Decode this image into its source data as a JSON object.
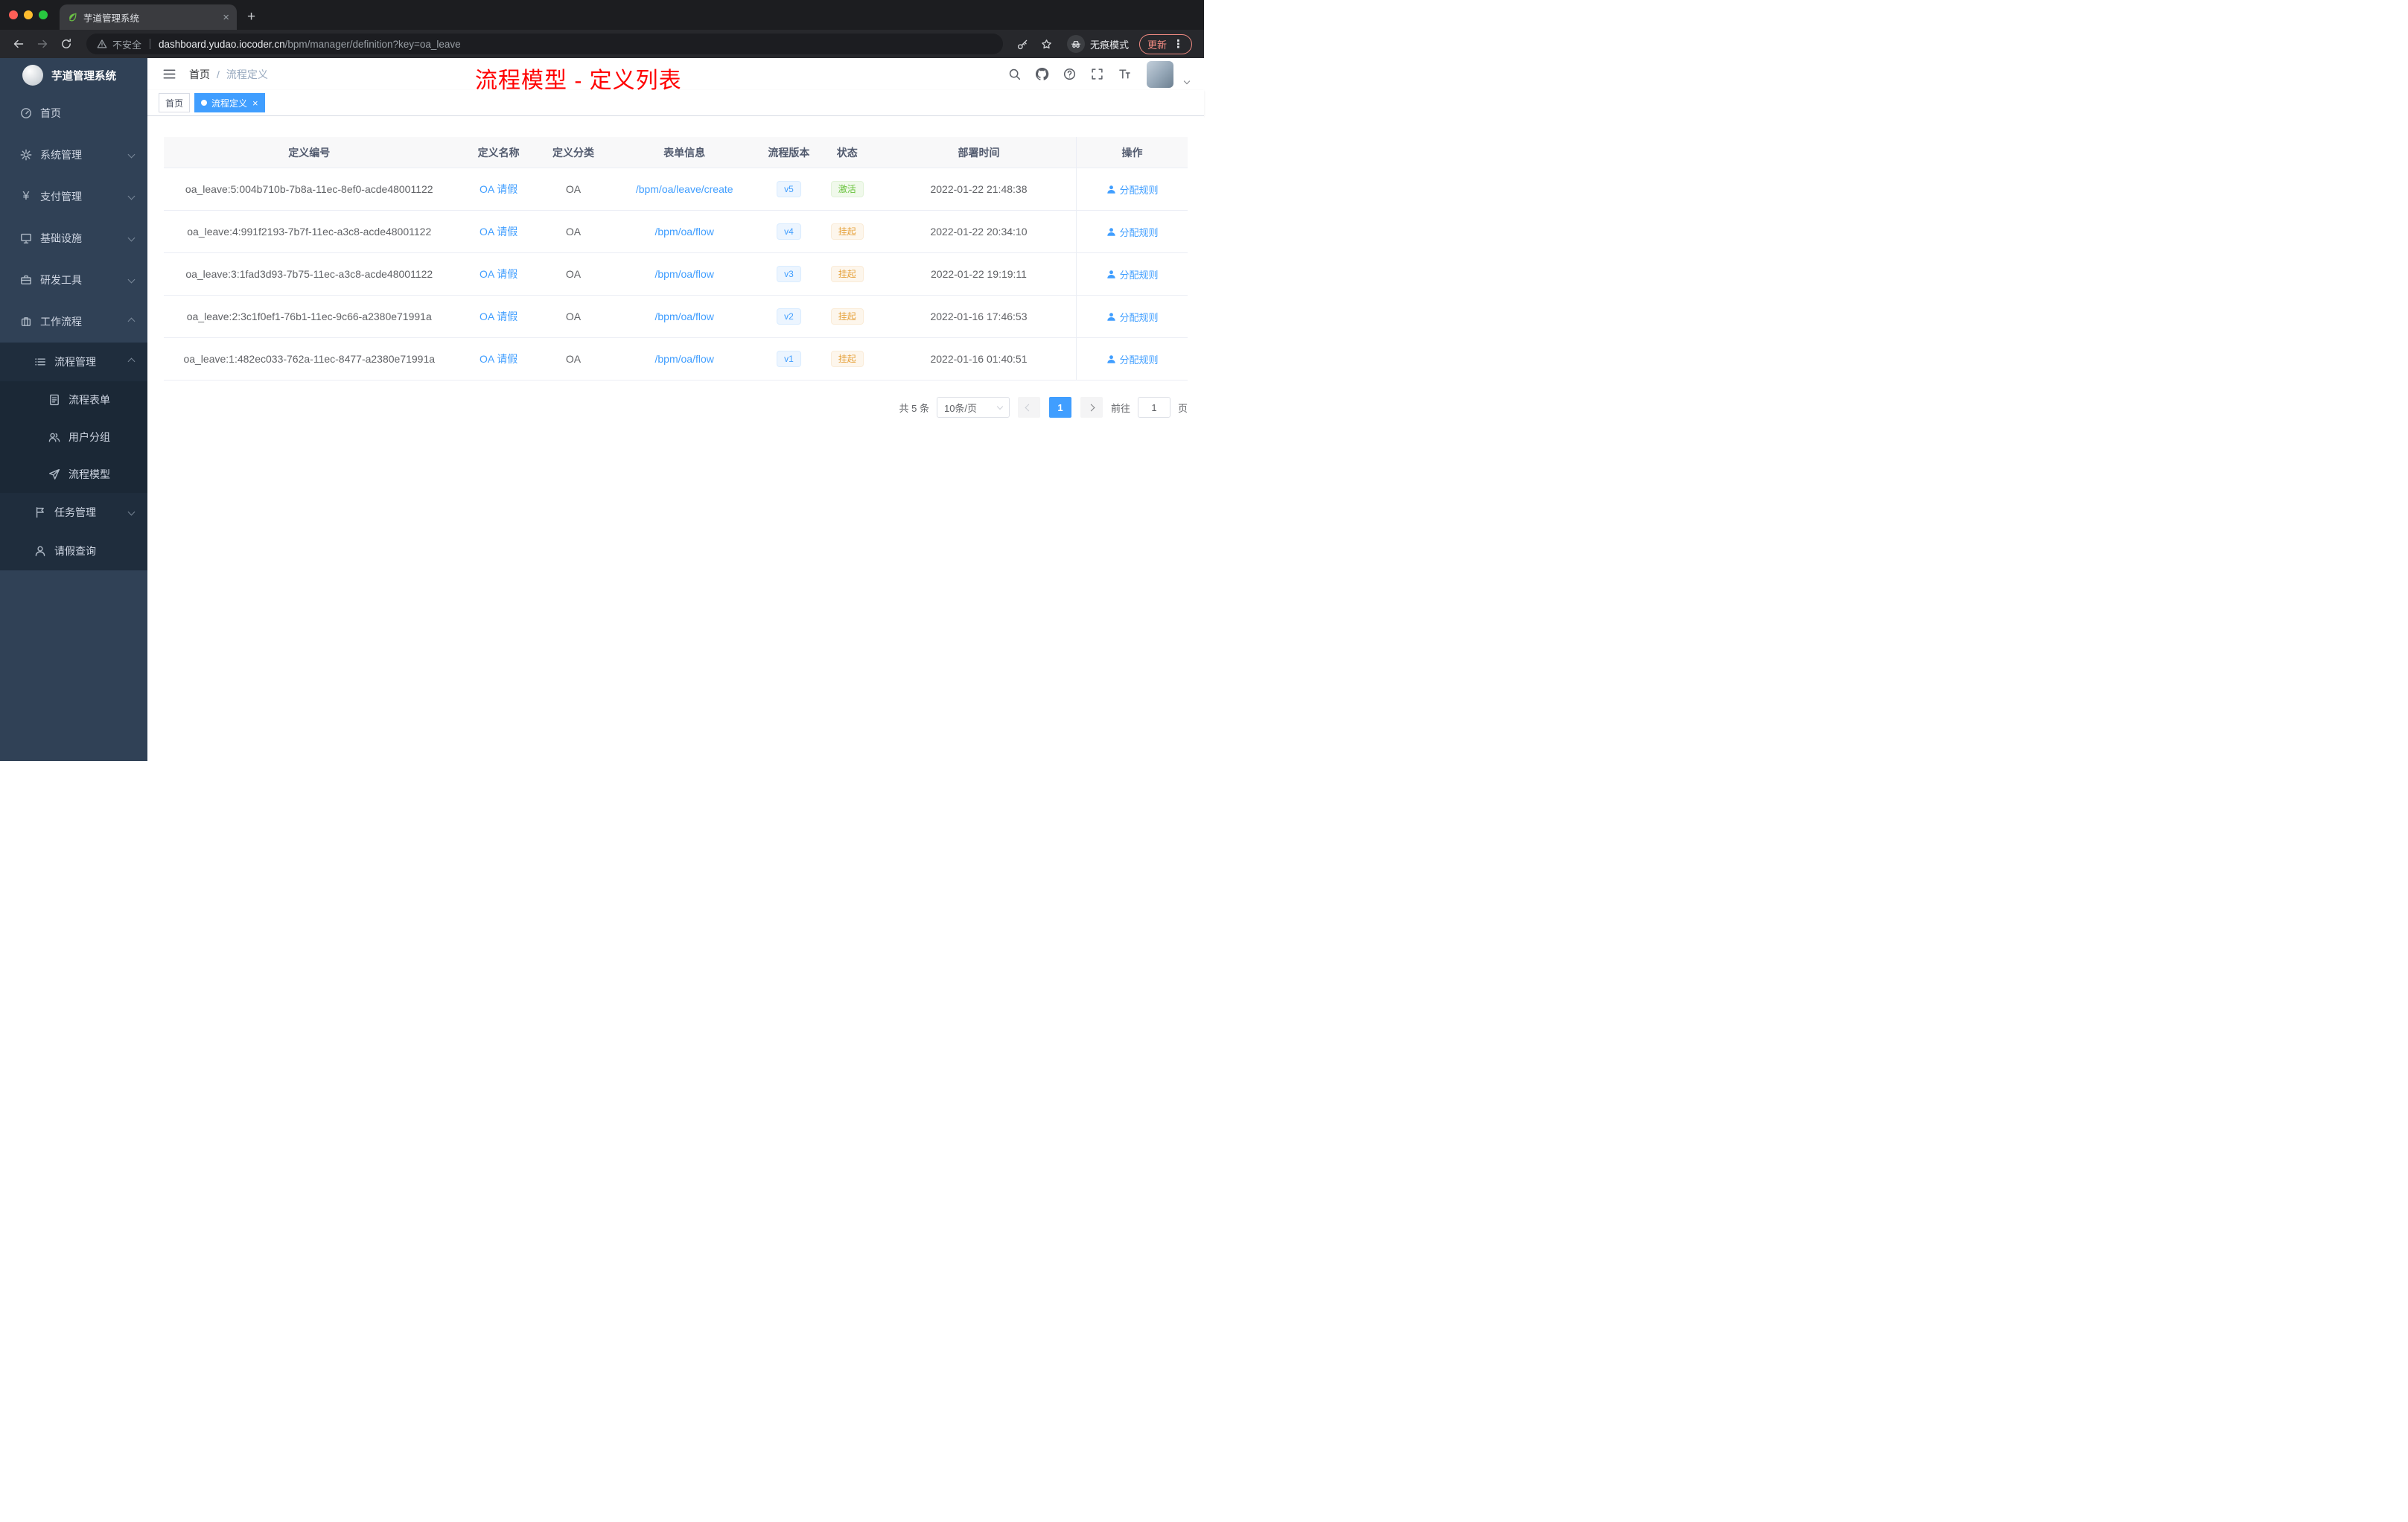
{
  "browser": {
    "tab": {
      "title": "芋道管理系统"
    },
    "new_tab_icon": "+",
    "address": {
      "security_label": "不安全",
      "host": "dashboard.yudao.iocoder.cn",
      "path": "/bpm/manager/definition?key=oa_leave"
    },
    "incognito_label": "无痕模式",
    "update_label": "更新"
  },
  "sidebar": {
    "logo_title": "芋道管理系统",
    "menu": [
      {
        "key": "home",
        "label": "首页",
        "icon": "dashboard"
      },
      {
        "key": "system-mgmt",
        "label": "系统管理",
        "icon": "gear",
        "chevron": "down"
      },
      {
        "key": "payment-mgmt",
        "label": "支付管理",
        "icon": "yen",
        "chevron": "down"
      },
      {
        "key": "infrastructure",
        "label": "基础设施",
        "icon": "monitor",
        "chevron": "down"
      },
      {
        "key": "dev-tools",
        "label": "研发工具",
        "icon": "briefcase",
        "chevron": "down"
      },
      {
        "key": "workflow",
        "label": "工作流程",
        "icon": "suitcase",
        "chevron": "up",
        "children": [
          {
            "key": "process-mgmt",
            "label": "流程管理",
            "icon": "list",
            "chevron": "up",
            "children": [
              {
                "key": "process-form",
                "label": "流程表单",
                "icon": "form"
              },
              {
                "key": "user-group",
                "label": "用户分组",
                "icon": "users"
              },
              {
                "key": "process-model",
                "label": "流程模型",
                "icon": "send"
              }
            ]
          },
          {
            "key": "task-mgmt",
            "label": "任务管理",
            "icon": "flag",
            "chevron": "down"
          },
          {
            "key": "leave-query",
            "label": "请假查询",
            "icon": "user"
          }
        ]
      }
    ]
  },
  "header": {
    "breadcrumb": {
      "home": "首页",
      "separator": "/",
      "current": "流程定义"
    },
    "annotation": "流程模型 - 定义列表"
  },
  "tags": [
    {
      "label": "首页",
      "active": false,
      "closable": false
    },
    {
      "label": "流程定义",
      "active": true,
      "closable": true
    }
  ],
  "table": {
    "columns": [
      "定义编号",
      "定义名称",
      "定义分类",
      "表单信息",
      "流程版本",
      "状态",
      "部署时间",
      "操作"
    ],
    "rows": [
      {
        "id": "oa_leave:5:004b710b-7b8a-11ec-8ef0-acde48001122",
        "name": "OA 请假",
        "category": "OA",
        "form": "/bpm/oa/leave/create",
        "version": "v5",
        "status": "激活",
        "status_type": "success",
        "time": "2022-01-22 21:48:38",
        "action": "分配规则"
      },
      {
        "id": "oa_leave:4:991f2193-7b7f-11ec-a3c8-acde48001122",
        "name": "OA 请假",
        "category": "OA",
        "form": "/bpm/oa/flow",
        "version": "v4",
        "status": "挂起",
        "status_type": "warning",
        "time": "2022-01-22 20:34:10",
        "action": "分配规则"
      },
      {
        "id": "oa_leave:3:1fad3d93-7b75-11ec-a3c8-acde48001122",
        "name": "OA 请假",
        "category": "OA",
        "form": "/bpm/oa/flow",
        "version": "v3",
        "status": "挂起",
        "status_type": "warning",
        "time": "2022-01-22 19:19:11",
        "action": "分配规则"
      },
      {
        "id": "oa_leave:2:3c1f0ef1-76b1-11ec-9c66-a2380e71991a",
        "name": "OA 请假",
        "category": "OA",
        "form": "/bpm/oa/flow",
        "version": "v2",
        "status": "挂起",
        "status_type": "warning",
        "time": "2022-01-16 17:46:53",
        "action": "分配规则"
      },
      {
        "id": "oa_leave:1:482ec033-762a-11ec-8477-a2380e71991a",
        "name": "OA 请假",
        "category": "OA",
        "form": "/bpm/oa/flow",
        "version": "v1",
        "status": "挂起",
        "status_type": "warning",
        "time": "2022-01-16 01:40:51",
        "action": "分配规则"
      }
    ]
  },
  "pagination": {
    "total": "共 5 条",
    "page_size": "10条/页",
    "current_page": "1",
    "goto_label": "前往",
    "goto_value": "1",
    "goto_suffix": "页"
  },
  "colors": {
    "accent": "#409eff",
    "success": "#67c23a",
    "warning": "#e6a23c",
    "annotation_red": "#ff0000",
    "sidebar_bg": "#304156",
    "submenu_bg": "#1f2d3d"
  }
}
